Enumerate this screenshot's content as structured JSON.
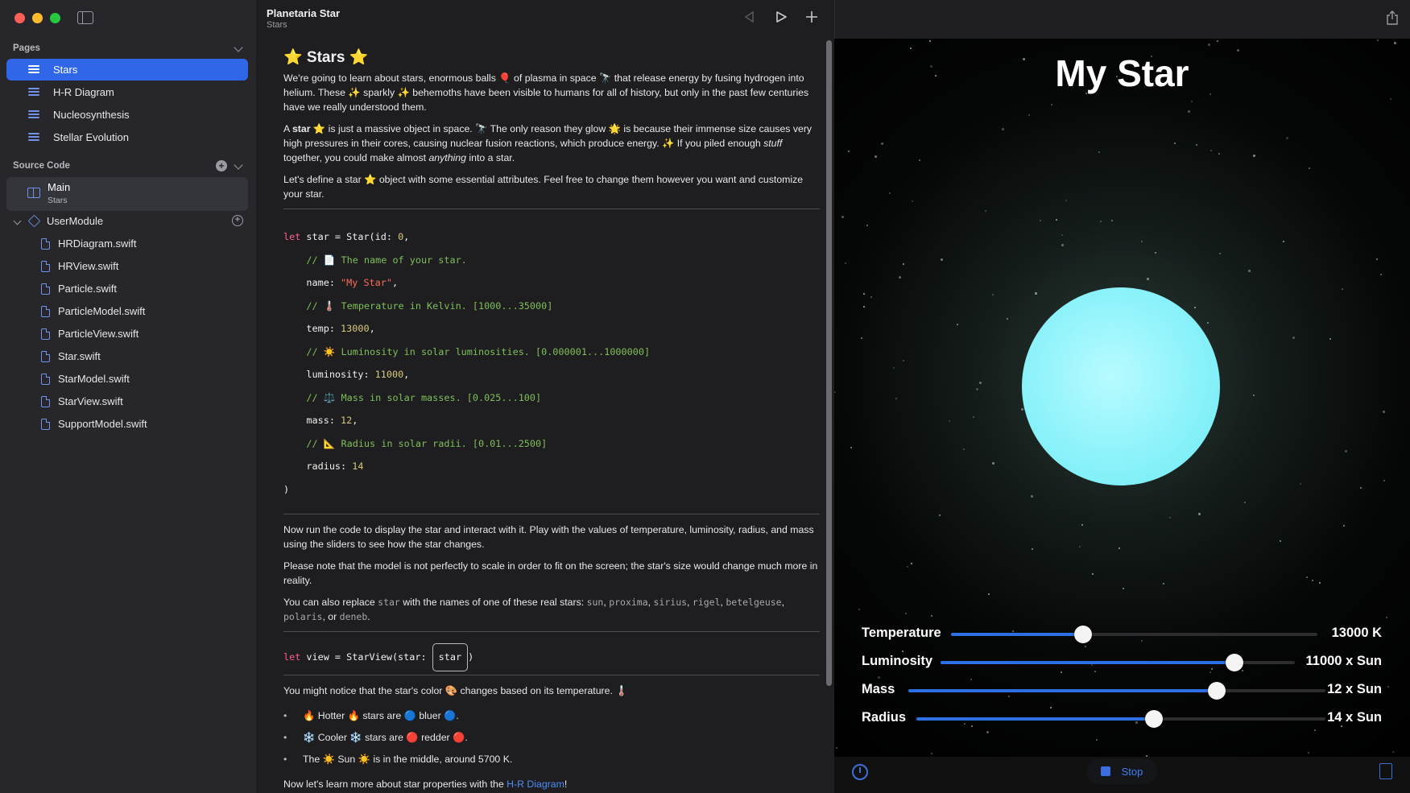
{
  "sidebar": {
    "pages_header": "Pages",
    "pages": [
      {
        "label": "Stars",
        "selected": true
      },
      {
        "label": "H-R Diagram"
      },
      {
        "label": "Nucleosynthesis"
      },
      {
        "label": "Stellar Evolution"
      }
    ],
    "source_header": "Source Code",
    "main": {
      "title": "Main",
      "subtitle": "Stars"
    },
    "module": "UserModule",
    "files": [
      "HRDiagram.swift",
      "HRView.swift",
      "Particle.swift",
      "ParticleModel.swift",
      "ParticleView.swift",
      "Star.swift",
      "StarModel.swift",
      "StarView.swift",
      "SupportModel.swift"
    ]
  },
  "editor": {
    "title": "Planetaria Star",
    "subtitle": "Stars",
    "heading": "⭐ Stars ⭐",
    "p1": "We're going to learn about stars, enormous balls 🎈 of plasma in space 🔭 that release energy by fusing hydrogen into helium. These ✨ sparkly ✨ behemoths have been visible to humans for all of history, but only in the past few centuries have we really understood them.",
    "p2_a": "A ",
    "p2_b": "star",
    "p2_c": " ⭐ is just a massive object in space. 🔭 The only reason they glow 🌟 is because their immense size causes very high pressures in their cores, causing nuclear fusion reactions, which produce energy. ✨ If you piled enough ",
    "p2_d": "stuff",
    "p2_e": " together, you could make almost ",
    "p2_f": "anything",
    "p2_g": " into a star.",
    "p3": "Let's define a star ⭐ object with some essential attributes. Feel free to change them however you want and customize your star.",
    "code": {
      "l1_kw": "let",
      "l1_rest": " star = Star(id: ",
      "l1_num": "0",
      "l1_end": ",",
      "c_name": "// 📄 The name of your star.",
      "name_key": "name: ",
      "name_val": "\"My Star\"",
      "c_temp": "// 🌡️ Temperature in Kelvin. [1000...35000]",
      "temp_key": "temp: ",
      "temp_val": "13000",
      "c_lum": "// ☀️ Luminosity in solar luminosities. [0.000001...1000000]",
      "lum_key": "luminosity: ",
      "lum_val": "11000",
      "c_mass": "// ⚖️ Mass in solar masses. [0.025...100]",
      "mass_key": "mass: ",
      "mass_val": "12",
      "c_rad": "// 📐 Radius in solar radii. [0.01...2500]",
      "rad_key": "radius: ",
      "rad_val": "14",
      "close": ")"
    },
    "p4": "Now run the code to display the star and interact with it. Play with the values of temperature, luminosity, radius, and mass using the sliders to see how the star changes.",
    "p5": "Please note that the model is not perfectly to scale in order to fit on the screen; the star's size would change much more in reality.",
    "p6_a": "You can also replace ",
    "p6_star": "star",
    "p6_b": " with the names of one of these real stars: ",
    "real_stars": [
      "sun",
      "proxima",
      "sirius",
      "rigel",
      "betelgeuse",
      "polaris",
      "deneb"
    ],
    "view_kw": "let",
    "view_rest": " view = StarView(star: ",
    "view_token": "star",
    "view_close": ")",
    "p7": "You might notice that the star's color 🎨 changes based on its temperature. 🌡️",
    "bullets": [
      "🔥 Hotter 🔥 stars are 🔵 bluer 🔵.",
      "❄️ Cooler ❄️ stars are 🔴 redder 🔴.",
      "The ☀️ Sun ☀️ is in the middle, around 5700 K."
    ],
    "p8_a": "Now let's learn more about star properties with the ",
    "p8_link": "H-R Diagram",
    "p8_b": "!"
  },
  "live": {
    "title": "My Star",
    "star_color": "#8cf2fa",
    "sliders": [
      {
        "label": "Temperature",
        "value": "13000 K",
        "fraction": 0.36
      },
      {
        "label": "Luminosity",
        "value": "11000 x Sun",
        "fraction": 0.83
      },
      {
        "label": "Mass",
        "value": "12 x Sun",
        "fraction": 0.74
      },
      {
        "label": "Radius",
        "value": "14 x Sun",
        "fraction": 0.58
      }
    ],
    "stop_label": "Stop"
  },
  "colors": {
    "accent": "#2f67e8",
    "keyword": "#fc5f8b",
    "number": "#d9c97c",
    "string": "#fc6a5d",
    "comment": "#7fbf5a"
  }
}
